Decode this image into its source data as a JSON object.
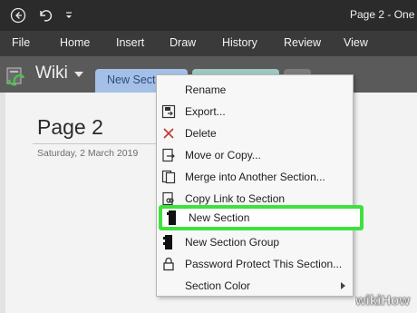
{
  "titlebar": {
    "title": "Page 2 - One",
    "icons": [
      "back-icon",
      "undo-icon",
      "quick-access-dropdown-icon"
    ]
  },
  "ribbon": {
    "tabs": [
      "File",
      "Home",
      "Insert",
      "Draw",
      "History",
      "Review",
      "View"
    ]
  },
  "notebook": {
    "name": "Wiki",
    "sections": [
      {
        "label": "New Sectio",
        "color": "#a4c0e6"
      },
      {
        "label": "",
        "color": "#9ec7c2"
      },
      {
        "label": "",
        "color": "#7c7c7c"
      }
    ]
  },
  "page": {
    "title": "Page 2",
    "date": "Saturday, 2 March 2019"
  },
  "context_menu": {
    "items": [
      {
        "label": "Rename",
        "icon": "none"
      },
      {
        "label": "Export...",
        "icon": "export-icon"
      },
      {
        "label": "Delete",
        "icon": "delete-x-icon"
      },
      {
        "label": "Move or Copy...",
        "icon": "move-copy-icon"
      },
      {
        "label": "Merge into Another Section...",
        "icon": "merge-icon"
      },
      {
        "label": "Copy Link to Section",
        "icon": "copy-link-icon"
      },
      {
        "label": "New Section",
        "icon": "new-section-icon",
        "highlighted": true
      },
      {
        "label": "New Section Group",
        "icon": "new-section-group-icon"
      },
      {
        "label": "Password Protect This Section...",
        "icon": "lock-icon"
      },
      {
        "label": "Section Color",
        "icon": "none",
        "submenu": true
      }
    ],
    "highlight_color": "#3de23d"
  },
  "watermark": "wikiHow"
}
